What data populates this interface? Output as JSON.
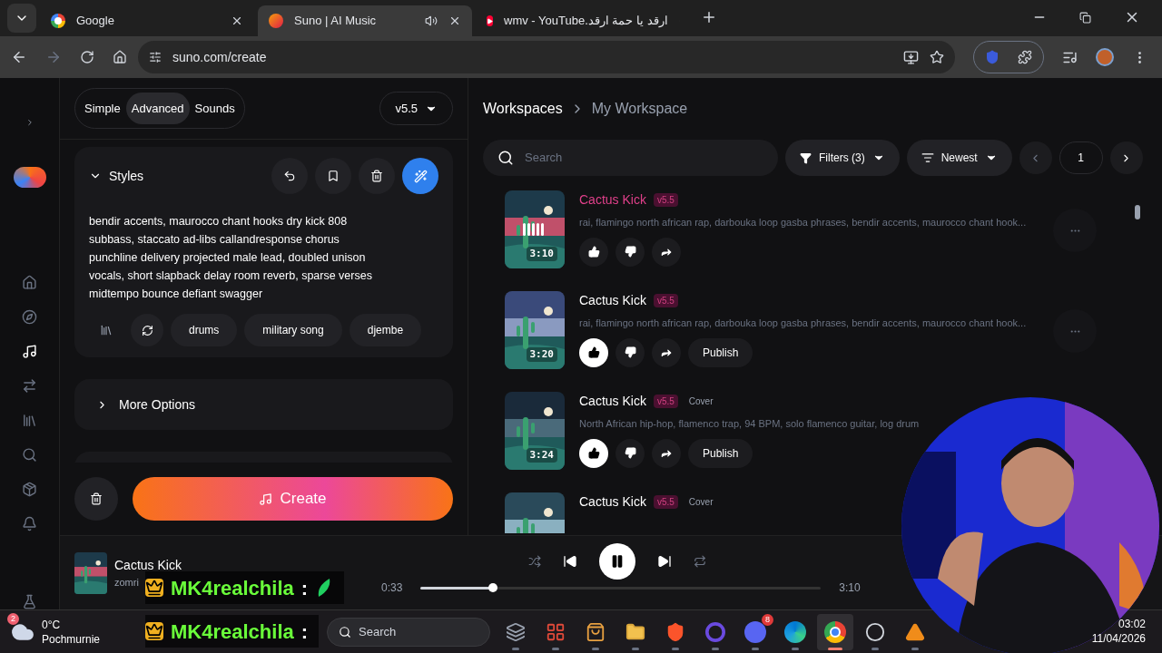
{
  "browser": {
    "tabs": [
      {
        "kind": "google",
        "title": "Google",
        "selected": false,
        "audio": false
      },
      {
        "kind": "suno",
        "title": "Suno | AI Music",
        "selected": true,
        "audio": true
      },
      {
        "kind": "youtube",
        "title": "ارقد يا حمة ارقد.wmv - YouTube",
        "selected": false,
        "audio": false
      }
    ],
    "url": "suno.com/create"
  },
  "nav": [
    {
      "kind": "home",
      "selected": false
    },
    {
      "kind": "explore",
      "selected": false
    },
    {
      "kind": "create",
      "selected": true
    },
    {
      "kind": "studio",
      "selected": false
    },
    {
      "kind": "library",
      "selected": false
    },
    {
      "kind": "search",
      "selected": false
    },
    {
      "kind": "hooks",
      "selected": false
    },
    {
      "kind": "notifications",
      "selected": false
    },
    {
      "kind": "labs",
      "selected": false
    }
  ],
  "create_panel": {
    "modes": [
      {
        "label": "Simple",
        "selected": false
      },
      {
        "label": "Advanced",
        "selected": true
      },
      {
        "label": "Sounds",
        "selected": false
      }
    ],
    "model": "v5.5",
    "styles": {
      "title": "Styles",
      "expanded": true,
      "text": "bendir accents, maurocco chant hooks dry kick 808 subbass, staccato ad-libs callandresponse chorus punchline delivery projected male lead, doubled unison vocals, short slapback delay room reverb, sparse verses midtempo bounce defiant swagger",
      "tags": [
        "drums",
        "military song",
        "djembe"
      ]
    },
    "more_options": {
      "title": "More Options",
      "expanded": false
    },
    "create_button": "Create"
  },
  "workspace": {
    "breadcrumb": [
      "Workspaces",
      "My Workspace"
    ],
    "search": {
      "placeholder": "Search"
    },
    "filters": "Filters (3)",
    "sort": "Newest",
    "page": "1",
    "songs": [
      {
        "title": "Cactus Kick",
        "playing": true,
        "version": "v5.5",
        "description": "rai, flamingo north african rap, darbouka loop gasba phrases, bendir accents, maurocco chant hook...",
        "duration": "3:10",
        "liked": false
      },
      {
        "title": "Cactus Kick",
        "playing": false,
        "version": "v5.5",
        "description": "rai, flamingo north african rap, darbouka loop gasba phrases, bendir accents, maurocco chant hook...",
        "duration": "3:20",
        "liked": true,
        "publish": "Publish"
      },
      {
        "title": "Cactus Kick",
        "playing": false,
        "version": "v5.5",
        "tag": "Cover",
        "description": "North African hip-hop, flamenco trap, 94 BPM, solo flamenco guitar, log drum",
        "duration": "3:24",
        "liked": true,
        "publish": "Publish"
      },
      {
        "title": "Cactus Kick",
        "playing": false,
        "version": "v5.5",
        "tag": "Cover"
      }
    ]
  },
  "player": {
    "title": "Cactus Kick",
    "artist": "zomri",
    "elapsed": "0:33",
    "total": "3:10",
    "level": 0.18,
    "playing": true
  },
  "chat": [
    {
      "user": "MK4realchila",
      "separator": ":"
    },
    {
      "user": "MK4realchila",
      "separator": ":"
    }
  ],
  "taskbar": {
    "weather": {
      "badge": "2",
      "temp": "0°C",
      "condition": "Pochmurnie"
    },
    "search": {
      "placeholder": "Search"
    },
    "apps": [
      {
        "kind": "taskview",
        "active": false
      },
      {
        "kind": "store",
        "active": false
      },
      {
        "kind": "shop",
        "active": false
      },
      {
        "kind": "folder",
        "active": false
      },
      {
        "kind": "brave",
        "active": false
      },
      {
        "kind": "ring",
        "active": false
      },
      {
        "kind": "discord",
        "active": false,
        "badge": "8"
      },
      {
        "kind": "edge",
        "active": false
      },
      {
        "kind": "chrome",
        "active": true
      },
      {
        "kind": "obs",
        "active": false
      },
      {
        "kind": "vlc",
        "active": false
      }
    ],
    "time": "03:02",
    "date": "11/04/2026"
  }
}
